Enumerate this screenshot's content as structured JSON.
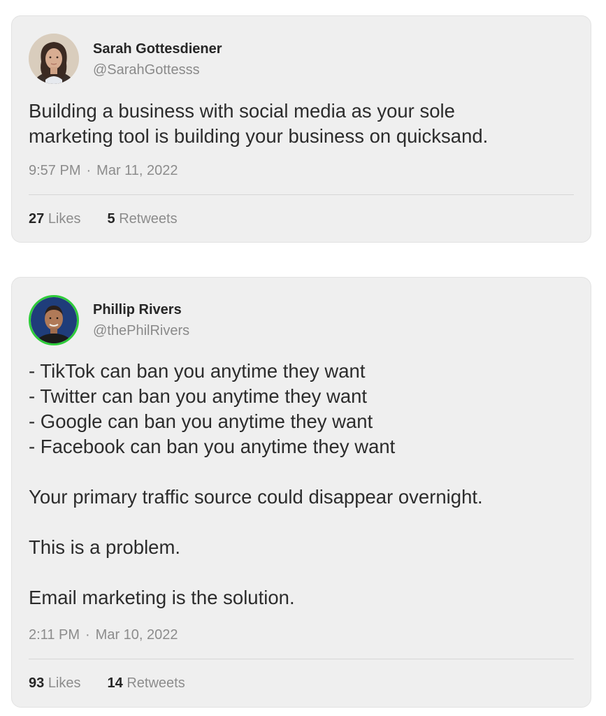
{
  "tweets": [
    {
      "author_name": "Sarah Gottesdiener",
      "author_handle": "@SarahGottesss",
      "text": "Building a business with social media as your sole\nmarketing tool is building your business on quicksand.",
      "time": "9:57 PM",
      "separator": "·",
      "date": "Mar 11, 2022",
      "likes_count": "27",
      "likes_label": "Likes",
      "retweets_count": "5",
      "retweets_label": "Retweets",
      "avatar_icon": "profile-photo"
    },
    {
      "author_name": "Phillip Rivers",
      "author_handle": "@thePhilRivers",
      "text": "- TikTok can ban you anytime they want\n- Twitter can ban you anytime they want\n- Google can ban you anytime they want\n- Facebook can ban you anytime they want\n\nYour primary traffic source could disappear overnight.\n\nThis is a problem.\n\nEmail marketing is the solution.",
      "time": "2:11 PM",
      "separator": "·",
      "date": "Mar 10, 2022",
      "likes_count": "93",
      "likes_label": "Likes",
      "retweets_count": "14",
      "retweets_label": "Retweets",
      "avatar_icon": "profile-photo",
      "avatar_ring_color": "#2ecc3a"
    }
  ],
  "colors": {
    "card_background": "#efefef",
    "muted_text": "#8c8c8c",
    "primary_text": "#2c2c2c"
  }
}
